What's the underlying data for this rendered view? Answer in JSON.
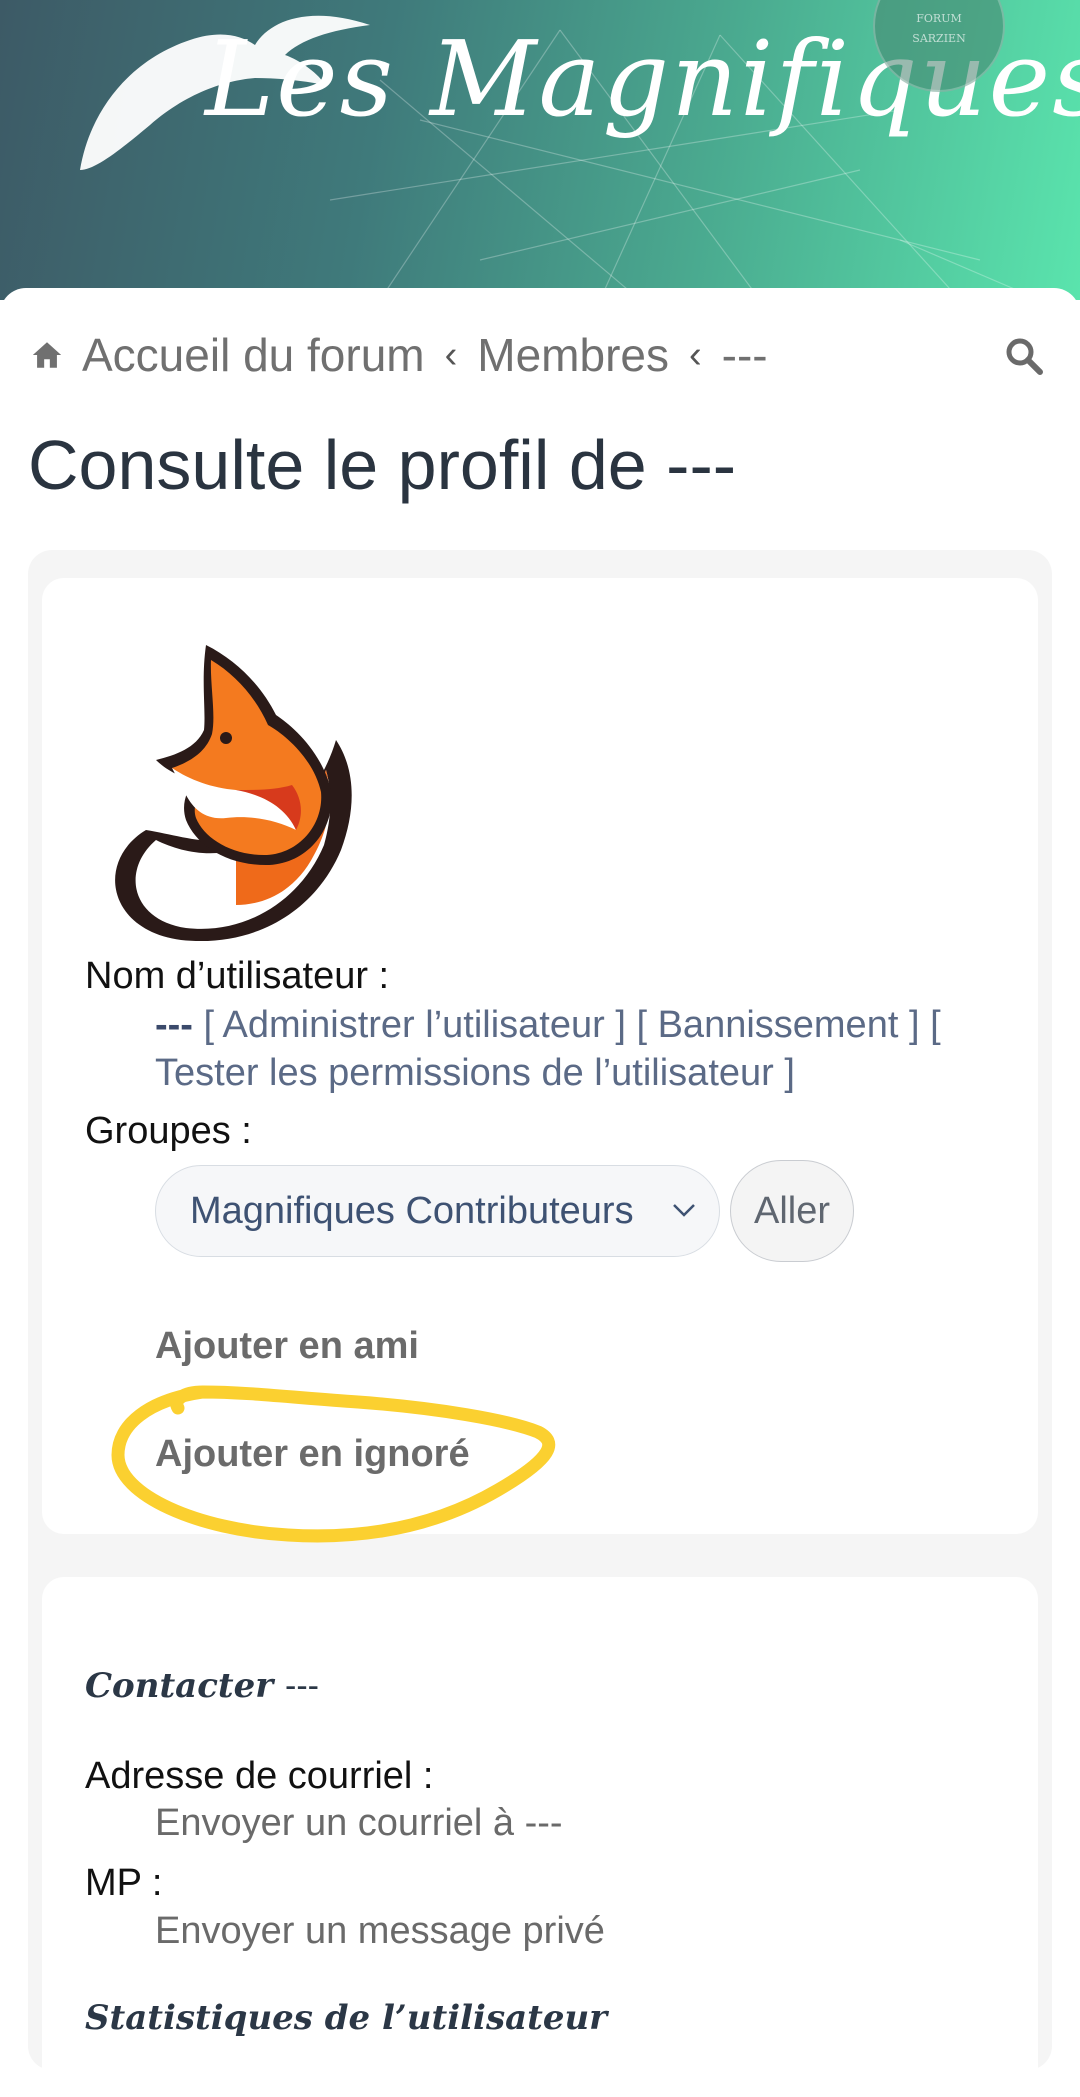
{
  "banner": {
    "logo_text": "Les Magnifiques",
    "badge_top": "FORUM",
    "badge_bottom": "SARZIEN"
  },
  "breadcrumb": {
    "home": "Accueil du forum",
    "members": "Membres",
    "user": "---",
    "separator": "‹"
  },
  "page": {
    "title": "Consulte le profil de ---"
  },
  "profile": {
    "username_label": "Nom d’utilisateur :",
    "username": "---",
    "admin_link": "[ Administrer l’utilisateur ]",
    "ban_link": "[ Bannissement ]",
    "perm_open": "[",
    "perm_link": "Tester les permissions de l’utilisateur ]",
    "groups_label": "Groupes :",
    "group_selected": "Magnifiques Contributeurs",
    "go_button": "Aller",
    "add_friend": "Ajouter en ami",
    "add_ignore": "Ajouter en ignoré"
  },
  "contact": {
    "title": "Contacter",
    "title_user": "---",
    "email_label": "Adresse de courriel :",
    "email_link": "Envoyer un courriel à ---",
    "pm_label": "MP :",
    "pm_link": "Envoyer un message privé"
  },
  "stats": {
    "title": "Statistiques de l’utilisateur"
  },
  "colors": {
    "banner_start": "#3d5a66",
    "banner_end": "#5ae4ad",
    "highlight": "#fbd030",
    "link": "#5b6a86"
  },
  "icons": [
    "home-icon",
    "search-icon",
    "chevron-down-icon",
    "bird-icon",
    "fox-avatar"
  ]
}
